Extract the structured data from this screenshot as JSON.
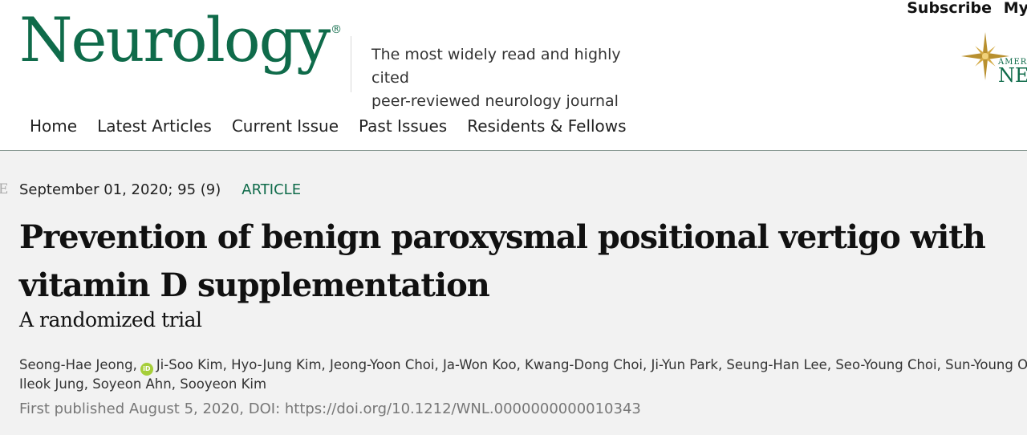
{
  "header": {
    "logo_text": "Neurology",
    "logo_mark": "®",
    "tagline_line1": "The most widely read and highly cited",
    "tagline_line2": "peer-reviewed neurology journal",
    "top_links": {
      "subscribe": "Subscribe",
      "my": "My"
    },
    "aan_logo_text1": "AMER",
    "aan_logo_text2": "NE",
    "brand_color": "#0f6b4a"
  },
  "nav": {
    "items": [
      "Home",
      "Latest Articles",
      "Current Issue",
      "Past Issues",
      "Residents & Fellows"
    ]
  },
  "article": {
    "edge_letter": "E",
    "date_issue": "September 01, 2020; 95 (9)",
    "type": "ARTICLE",
    "title": "Prevention of benign paroxysmal positional vertigo with vitamin D supplementation",
    "subtitle": "A randomized trial",
    "authors_line1_a": "Seong-Hae Jeong,",
    "orcid_icon": "iD",
    "authors_line1_b": "Ji-Soo Kim, Hyo-Jung Kim, Jeong-Yoon Choi, Ja-Won Koo, Kwang-Dong Choi, Ji-Yun Park, Seung-Han Lee, Seo-Young Choi, Sun-Young Oh, Tae",
    "authors_line2": "Ileok Jung, Soyeon Ahn, Sooyeon Kim",
    "published": "First published August 5, 2020, DOI: https://doi.org/10.1212/WNL.0000000000010343"
  }
}
